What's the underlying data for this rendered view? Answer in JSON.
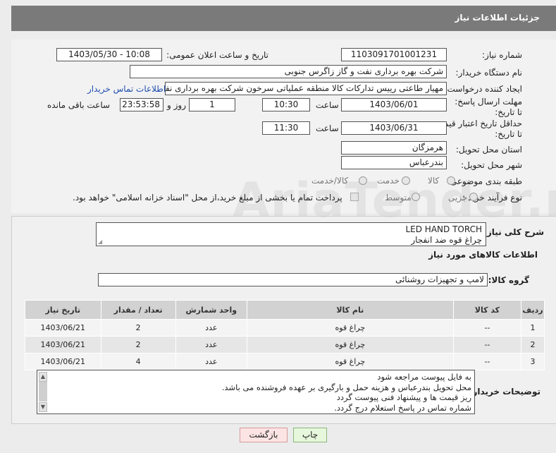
{
  "header": {
    "title": "جزئیات اطلاعات نیاز"
  },
  "form": {
    "need_number": {
      "label": "شماره نیاز:",
      "value": "1103091701001231"
    },
    "announce": {
      "label": "تاریخ و ساعت اعلان عمومی:",
      "value": "1403/05/30 - 10:08"
    },
    "buyer_org": {
      "label": "نام دستگاه خریدار:",
      "value": "شرکت بهره برداری نفت و گاز زاگرس جنوبی"
    },
    "creator": {
      "label": "ایجاد کننده درخواست:",
      "value": "مهیار  طاعتی رییس تدارکات کالا منطقه عملیاتی سرخون شرکت بهره برداری نفت",
      "contact_link": "اطلاعات تماس خریدار"
    },
    "reply_deadline": {
      "label": "مهلت ارسال پاسخ: تا تاریخ:",
      "date": "1403/06/01",
      "time_label": "ساعت",
      "time": "10:30",
      "days": "1",
      "days_label": "روز و",
      "remaining": "23:53:58",
      "remaining_label": "ساعت باقی مانده"
    },
    "price_validity": {
      "label": "حداقل تاریخ اعتبار قیمت: تا تاریخ:",
      "date": "1403/06/31",
      "time_label": "ساعت",
      "time": "11:30"
    },
    "province": {
      "label": "استان محل تحویل:",
      "value": "هرمزگان"
    },
    "city": {
      "label": "شهر محل تحویل:",
      "value": "بندرعباس"
    },
    "category": {
      "label": "طبقه بندی موضوعی:",
      "options": [
        "کالا",
        "خدمت",
        "کالا/خدمت"
      ]
    },
    "process": {
      "label": "نوع فرآیند خرید :",
      "options": [
        "جزیی",
        "متوسط"
      ],
      "note": "پرداخت تمام یا بخشی از مبلغ خرید،از محل \"اسناد خزانه اسلامی\" خواهد بود."
    }
  },
  "description": {
    "label": "شرح کلی نیاز:",
    "line1": "LED HAND TORCH",
    "line2": "چراغ قوه ضد انفجار"
  },
  "goods": {
    "section_title": "اطلاعات کالاهای مورد نیاز",
    "group_label": "گروه کالا:",
    "group_value": "لامپ و تجهیزات روشنائی",
    "columns": [
      "ردیف",
      "کد کالا",
      "نام کالا",
      "واحد شمارش",
      "تعداد / مقدار",
      "تاریخ نیاز"
    ],
    "rows": [
      {
        "idx": "1",
        "code": "--",
        "name": "چراغ قوه",
        "unit": "عدد",
        "qty": "2",
        "date": "1403/06/21"
      },
      {
        "idx": "2",
        "code": "--",
        "name": "چراغ قوه",
        "unit": "عدد",
        "qty": "2",
        "date": "1403/06/21"
      },
      {
        "idx": "3",
        "code": "--",
        "name": "چراغ قوه",
        "unit": "عدد",
        "qty": "4",
        "date": "1403/06/21"
      }
    ]
  },
  "buyer_notes": {
    "label": "توضیحات خریدار:",
    "lines": [
      "به فایل پیوست مراجعه شود",
      "محل تحویل  بندرعباس و هزینه حمل و بارگیری  بر عهده فروشنده می باشد.",
      "ریز قیمت ها و پیشنهاد فنی پیوست گردد",
      "شماره تماس در پاسخ استعلام درج گردد."
    ]
  },
  "buttons": {
    "print": "چاپ",
    "back": "بازگشت"
  },
  "watermark": "AriaTender.net"
}
